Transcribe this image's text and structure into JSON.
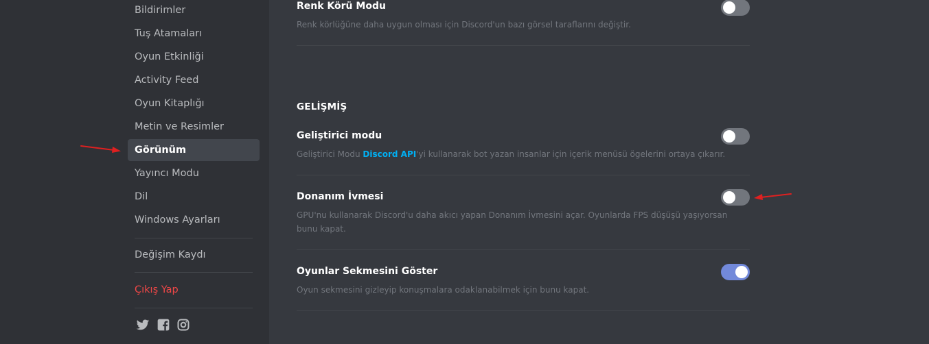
{
  "sidebar": {
    "items": [
      {
        "label": "Bildirimler"
      },
      {
        "label": "Tuş Atamaları"
      },
      {
        "label": "Oyun Etkinliği"
      },
      {
        "label": "Activity Feed"
      },
      {
        "label": "Oyun Kitaplığı"
      },
      {
        "label": "Metin ve Resimler"
      },
      {
        "label": "Görünüm"
      },
      {
        "label": "Yayıncı Modu"
      },
      {
        "label": "Dil"
      },
      {
        "label": "Windows Ayarları"
      }
    ],
    "changelog": "Değişim Kaydı",
    "logout": "Çıkış Yap",
    "selected": "Görünüm",
    "social_icons": [
      "twitter-icon",
      "facebook-icon",
      "instagram-icon"
    ]
  },
  "main": {
    "colorblind": {
      "title": "Renk Körü Modu",
      "description": "Renk körlüğüne daha uygun olması için Discord'un bazı görsel taraflarını değiştir.",
      "enabled": false
    },
    "advanced": {
      "header": "GELİŞMİŞ",
      "developer_mode": {
        "title": "Geliştirici modu",
        "desc_before": "Geliştirici Modu ",
        "desc_link": "Discord API",
        "desc_after": "'yi kullanarak bot yazan insanlar için içerik menüsü ögelerini ortaya çıkarır.",
        "enabled": false
      },
      "hardware_acceleration": {
        "title": "Donanım İvmesi",
        "description": "GPU'nu kullanarak Discord'u daha akıcı yapan Donanım İvmesini açar. Oyunlarda FPS düşüşü yaşıyorsan bunu kapat.",
        "enabled": false
      },
      "games_tab": {
        "title": "Oyunlar Sekmesini Göster",
        "description": "Oyun sekmesini gizleyip konuşmalara odaklanabilmek için bunu kapat.",
        "enabled": true
      }
    }
  },
  "colors": {
    "background": "#36393f",
    "sidebar": "#2f3136",
    "selected": "#42464d",
    "accent": "#7289da",
    "link": "#00b0f4",
    "danger": "#f04747",
    "annotation_arrow": "#e02020"
  }
}
